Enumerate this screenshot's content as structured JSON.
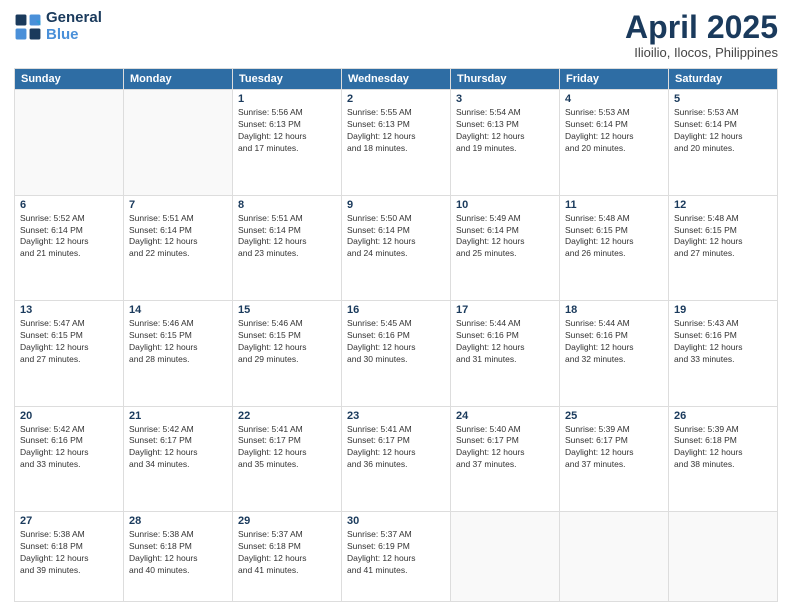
{
  "header": {
    "logo_line1": "General",
    "logo_line2": "Blue",
    "title": "April 2025",
    "subtitle": "Ilioilio, Ilocos, Philippines"
  },
  "weekdays": [
    "Sunday",
    "Monday",
    "Tuesday",
    "Wednesday",
    "Thursday",
    "Friday",
    "Saturday"
  ],
  "weeks": [
    [
      {
        "day": "",
        "info": ""
      },
      {
        "day": "",
        "info": ""
      },
      {
        "day": "1",
        "info": "Sunrise: 5:56 AM\nSunset: 6:13 PM\nDaylight: 12 hours\nand 17 minutes."
      },
      {
        "day": "2",
        "info": "Sunrise: 5:55 AM\nSunset: 6:13 PM\nDaylight: 12 hours\nand 18 minutes."
      },
      {
        "day": "3",
        "info": "Sunrise: 5:54 AM\nSunset: 6:13 PM\nDaylight: 12 hours\nand 19 minutes."
      },
      {
        "day": "4",
        "info": "Sunrise: 5:53 AM\nSunset: 6:14 PM\nDaylight: 12 hours\nand 20 minutes."
      },
      {
        "day": "5",
        "info": "Sunrise: 5:53 AM\nSunset: 6:14 PM\nDaylight: 12 hours\nand 20 minutes."
      }
    ],
    [
      {
        "day": "6",
        "info": "Sunrise: 5:52 AM\nSunset: 6:14 PM\nDaylight: 12 hours\nand 21 minutes."
      },
      {
        "day": "7",
        "info": "Sunrise: 5:51 AM\nSunset: 6:14 PM\nDaylight: 12 hours\nand 22 minutes."
      },
      {
        "day": "8",
        "info": "Sunrise: 5:51 AM\nSunset: 6:14 PM\nDaylight: 12 hours\nand 23 minutes."
      },
      {
        "day": "9",
        "info": "Sunrise: 5:50 AM\nSunset: 6:14 PM\nDaylight: 12 hours\nand 24 minutes."
      },
      {
        "day": "10",
        "info": "Sunrise: 5:49 AM\nSunset: 6:14 PM\nDaylight: 12 hours\nand 25 minutes."
      },
      {
        "day": "11",
        "info": "Sunrise: 5:48 AM\nSunset: 6:15 PM\nDaylight: 12 hours\nand 26 minutes."
      },
      {
        "day": "12",
        "info": "Sunrise: 5:48 AM\nSunset: 6:15 PM\nDaylight: 12 hours\nand 27 minutes."
      }
    ],
    [
      {
        "day": "13",
        "info": "Sunrise: 5:47 AM\nSunset: 6:15 PM\nDaylight: 12 hours\nand 27 minutes."
      },
      {
        "day": "14",
        "info": "Sunrise: 5:46 AM\nSunset: 6:15 PM\nDaylight: 12 hours\nand 28 minutes."
      },
      {
        "day": "15",
        "info": "Sunrise: 5:46 AM\nSunset: 6:15 PM\nDaylight: 12 hours\nand 29 minutes."
      },
      {
        "day": "16",
        "info": "Sunrise: 5:45 AM\nSunset: 6:16 PM\nDaylight: 12 hours\nand 30 minutes."
      },
      {
        "day": "17",
        "info": "Sunrise: 5:44 AM\nSunset: 6:16 PM\nDaylight: 12 hours\nand 31 minutes."
      },
      {
        "day": "18",
        "info": "Sunrise: 5:44 AM\nSunset: 6:16 PM\nDaylight: 12 hours\nand 32 minutes."
      },
      {
        "day": "19",
        "info": "Sunrise: 5:43 AM\nSunset: 6:16 PM\nDaylight: 12 hours\nand 33 minutes."
      }
    ],
    [
      {
        "day": "20",
        "info": "Sunrise: 5:42 AM\nSunset: 6:16 PM\nDaylight: 12 hours\nand 33 minutes."
      },
      {
        "day": "21",
        "info": "Sunrise: 5:42 AM\nSunset: 6:17 PM\nDaylight: 12 hours\nand 34 minutes."
      },
      {
        "day": "22",
        "info": "Sunrise: 5:41 AM\nSunset: 6:17 PM\nDaylight: 12 hours\nand 35 minutes."
      },
      {
        "day": "23",
        "info": "Sunrise: 5:41 AM\nSunset: 6:17 PM\nDaylight: 12 hours\nand 36 minutes."
      },
      {
        "day": "24",
        "info": "Sunrise: 5:40 AM\nSunset: 6:17 PM\nDaylight: 12 hours\nand 37 minutes."
      },
      {
        "day": "25",
        "info": "Sunrise: 5:39 AM\nSunset: 6:17 PM\nDaylight: 12 hours\nand 37 minutes."
      },
      {
        "day": "26",
        "info": "Sunrise: 5:39 AM\nSunset: 6:18 PM\nDaylight: 12 hours\nand 38 minutes."
      }
    ],
    [
      {
        "day": "27",
        "info": "Sunrise: 5:38 AM\nSunset: 6:18 PM\nDaylight: 12 hours\nand 39 minutes."
      },
      {
        "day": "28",
        "info": "Sunrise: 5:38 AM\nSunset: 6:18 PM\nDaylight: 12 hours\nand 40 minutes."
      },
      {
        "day": "29",
        "info": "Sunrise: 5:37 AM\nSunset: 6:18 PM\nDaylight: 12 hours\nand 41 minutes."
      },
      {
        "day": "30",
        "info": "Sunrise: 5:37 AM\nSunset: 6:19 PM\nDaylight: 12 hours\nand 41 minutes."
      },
      {
        "day": "",
        "info": ""
      },
      {
        "day": "",
        "info": ""
      },
      {
        "day": "",
        "info": ""
      }
    ]
  ]
}
